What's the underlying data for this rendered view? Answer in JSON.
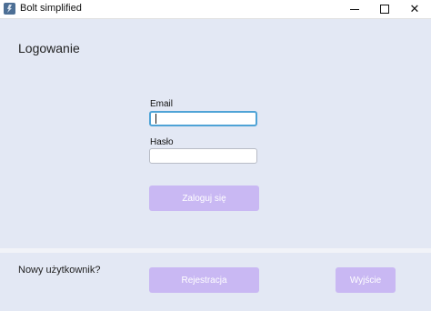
{
  "window": {
    "title": "Bolt simplified",
    "controls": {
      "minimize": "minimize-icon",
      "maximize": "maximize-icon",
      "close": "✕"
    }
  },
  "login": {
    "heading": "Logowanie",
    "email_label": "Email",
    "email_value": "",
    "password_label": "Hasło",
    "password_value": "",
    "submit_label": "Zaloguj się"
  },
  "footer": {
    "new_user_text": "Nowy użytkownik?",
    "register_label": "Rejestracja",
    "exit_label": "Wyjście"
  },
  "colors": {
    "background": "#e3e8f4",
    "button": "#c9b8f3",
    "focus_border": "#4fa3d6"
  }
}
